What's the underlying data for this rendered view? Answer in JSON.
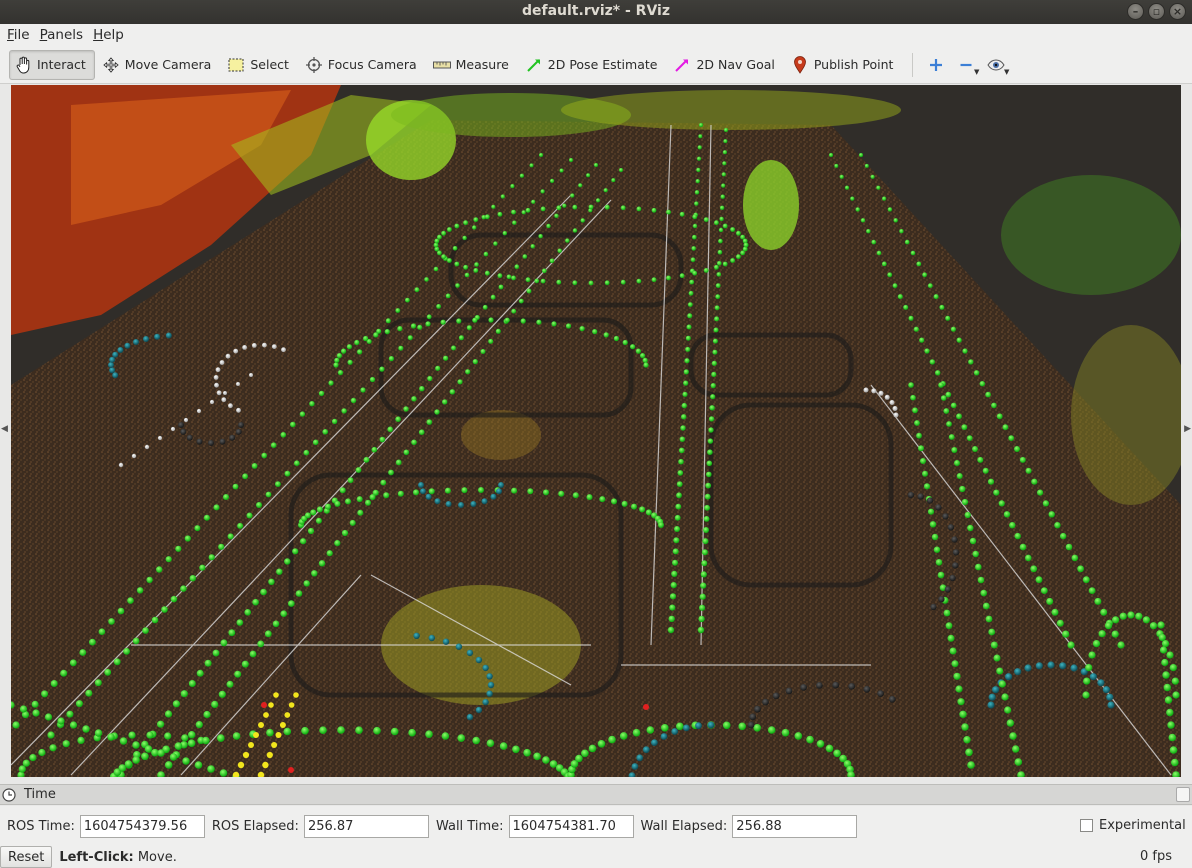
{
  "window": {
    "title": "default.rviz* - RViz"
  },
  "menu": [
    {
      "label": "File",
      "mnemonic": "F",
      "rest": "ile"
    },
    {
      "label": "Panels",
      "mnemonic": "P",
      "rest": "anels"
    },
    {
      "label": "Help",
      "mnemonic": "H",
      "rest": "elp"
    }
  ],
  "toolbar": {
    "tools": [
      {
        "label": "Interact",
        "icon": "hand-icon",
        "active": true
      },
      {
        "label": "Move Camera",
        "icon": "move-camera-icon",
        "active": false
      },
      {
        "label": "Select",
        "icon": "select-icon",
        "active": false
      },
      {
        "label": "Focus Camera",
        "icon": "focus-camera-icon",
        "active": false
      },
      {
        "label": "Measure",
        "icon": "ruler-icon",
        "active": false
      },
      {
        "label": "2D Pose Estimate",
        "icon": "pose-estimate-arrow-icon",
        "active": false
      },
      {
        "label": "2D Nav Goal",
        "icon": "nav-goal-arrow-icon",
        "active": false
      },
      {
        "label": "Publish Point",
        "icon": "map-pin-icon",
        "active": false
      }
    ],
    "extra_buttons": [
      "add-tool-icon",
      "remove-tool-icon",
      "views-eye-icon"
    ],
    "colors": {
      "pose_estimate": "#22c322",
      "nav_goal": "#e21ce2",
      "publish_point": "#c63b1c",
      "add": "#3c7fd6"
    }
  },
  "viewport": {
    "description_icon": "3d-pointcloud-render",
    "colors": {
      "background": "#302d29",
      "ground": "#5a3f24",
      "waypoint_green": "#1fd41f",
      "waypoint_teal": "#1a6e78",
      "waypoint_white": "#e6e6e6",
      "lane_line": "#dcdcdc",
      "vegetation": "#9bd81b",
      "building_red": "#c93b12"
    }
  },
  "time_panel": {
    "title": "Time",
    "ros_time_label": "ROS Time:",
    "ros_time": "1604754379.56",
    "ros_elapsed_label": "ROS Elapsed:",
    "ros_elapsed": "256.87",
    "wall_time_label": "Wall Time:",
    "wall_time": "1604754381.70",
    "wall_elapsed_label": "Wall Elapsed:",
    "wall_elapsed": "256.88",
    "experimental_label": "Experimental",
    "experimental_checked": false
  },
  "statusbar": {
    "reset_label": "Reset",
    "hint_key": "Left-Click:",
    "hint_text": " Move.",
    "fps": "0 fps"
  }
}
